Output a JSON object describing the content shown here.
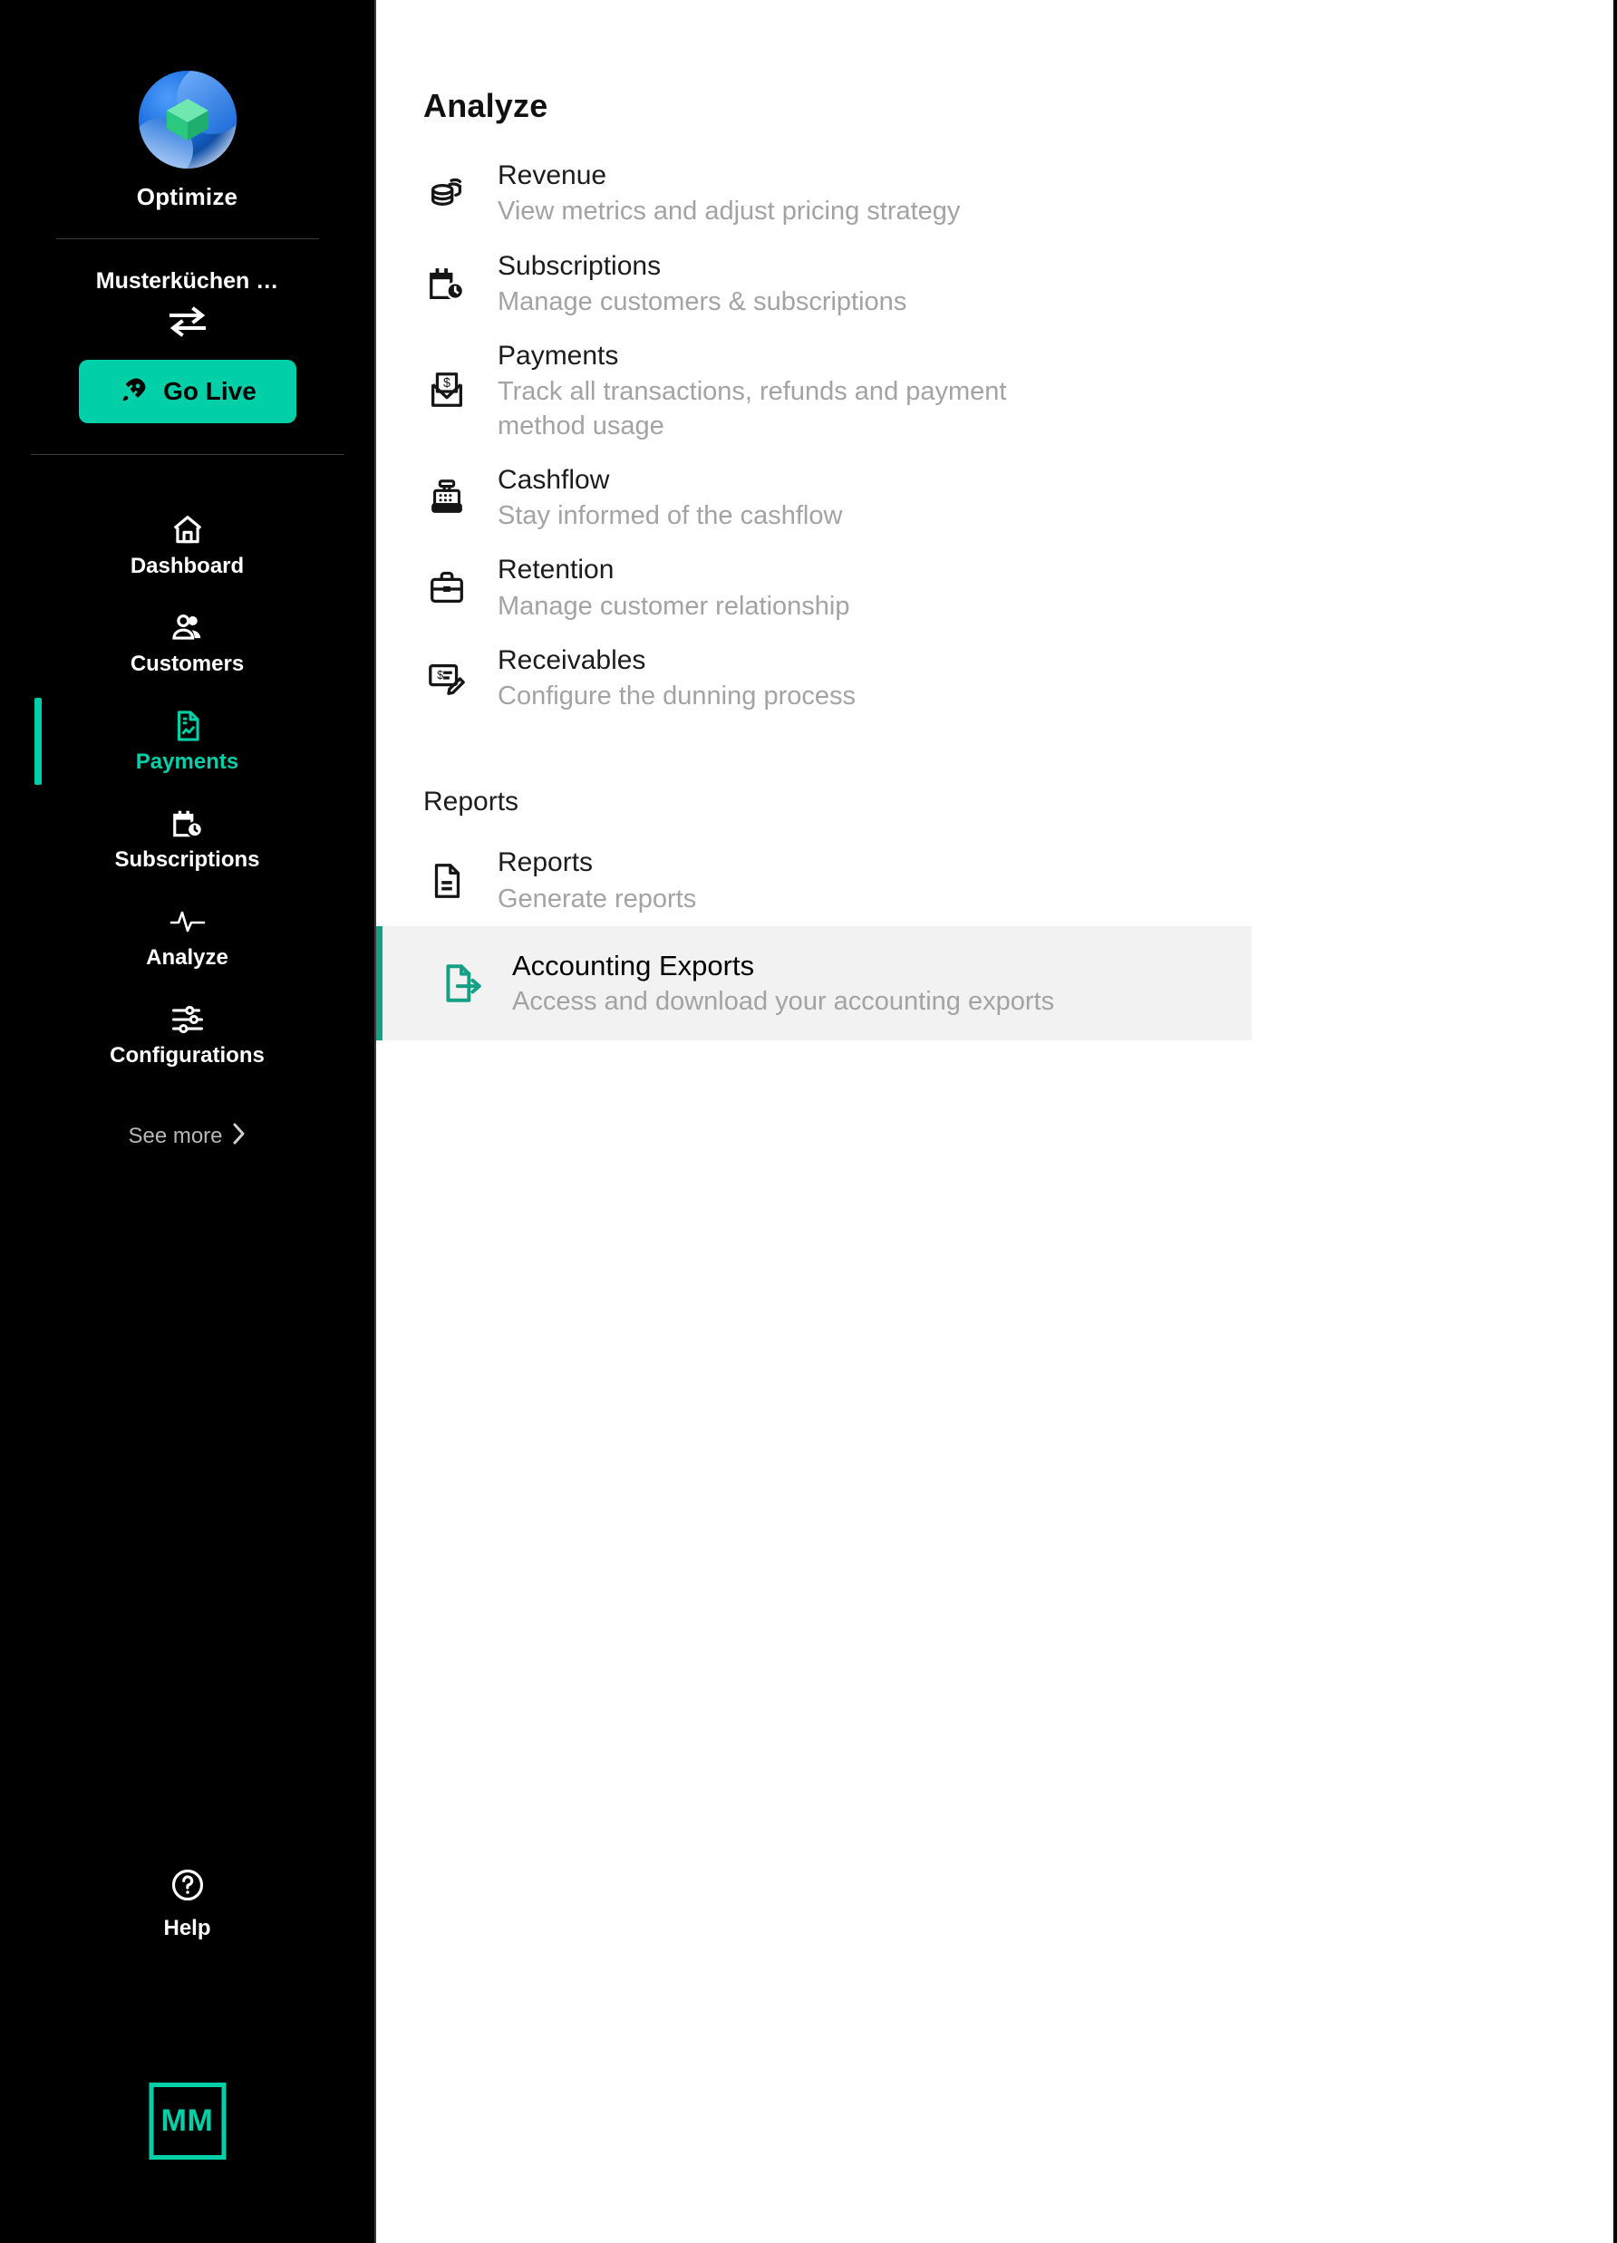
{
  "sidebar": {
    "brand_name": "Optimize",
    "brand_logo_icon": "optimize-logo-icon",
    "org_name": "Musterküchen …",
    "switch_org_icon": "switch-arrows-icon",
    "go_live": {
      "label": "Go Live",
      "icon": "rocket-icon",
      "color": "#00cfa8"
    },
    "nav_items": [
      {
        "label": "Dashboard",
        "icon": "home-icon",
        "active": false
      },
      {
        "label": "Customers",
        "icon": "users-icon",
        "active": false
      },
      {
        "label": "Payments",
        "icon": "payment-document-icon",
        "active": true
      },
      {
        "label": "Subscriptions",
        "icon": "calendar-clock-icon",
        "active": false
      },
      {
        "label": "Analyze",
        "icon": "pulse-icon",
        "active": false
      },
      {
        "label": "Configurations",
        "icon": "sliders-icon",
        "active": false
      }
    ],
    "see_more": {
      "label": "See more",
      "icon": "chevron-right-icon"
    },
    "help": {
      "label": "Help",
      "icon": "question-circle-icon"
    },
    "avatar": {
      "initials": "MM",
      "color": "#00cfa8"
    }
  },
  "main": {
    "analyze_title": "Analyze",
    "analyze_items": [
      {
        "title": "Revenue",
        "desc": "View metrics and adjust pricing strategy",
        "icon": "coins-stack-icon"
      },
      {
        "title": "Subscriptions",
        "desc": "Manage customers & subscriptions",
        "icon": "calendar-clock-icon"
      },
      {
        "title": "Payments",
        "desc": "Track all transactions, refunds and payment method usage",
        "icon": "envelope-dollar-icon"
      },
      {
        "title": "Cashflow",
        "desc": "Stay informed of the cashflow",
        "icon": "cash-register-icon"
      },
      {
        "title": "Retention",
        "desc": "Manage customer relationship",
        "icon": "briefcase-icon"
      },
      {
        "title": "Receivables",
        "desc": "Configure the dunning process",
        "icon": "invoice-edit-icon"
      }
    ],
    "reports_label": "Reports",
    "reports_items": [
      {
        "title": "Reports",
        "desc": "Generate reports",
        "icon": "document-icon",
        "highlighted": false
      },
      {
        "title": "Accounting Exports",
        "desc": "Access and download your accounting exports",
        "icon": "document-export-icon",
        "highlighted": true
      }
    ]
  },
  "annotation": {
    "arrow_icon": "left-pointing-arrow",
    "arrow_color": "#00c3a5",
    "points_at": "Accounting Exports"
  }
}
